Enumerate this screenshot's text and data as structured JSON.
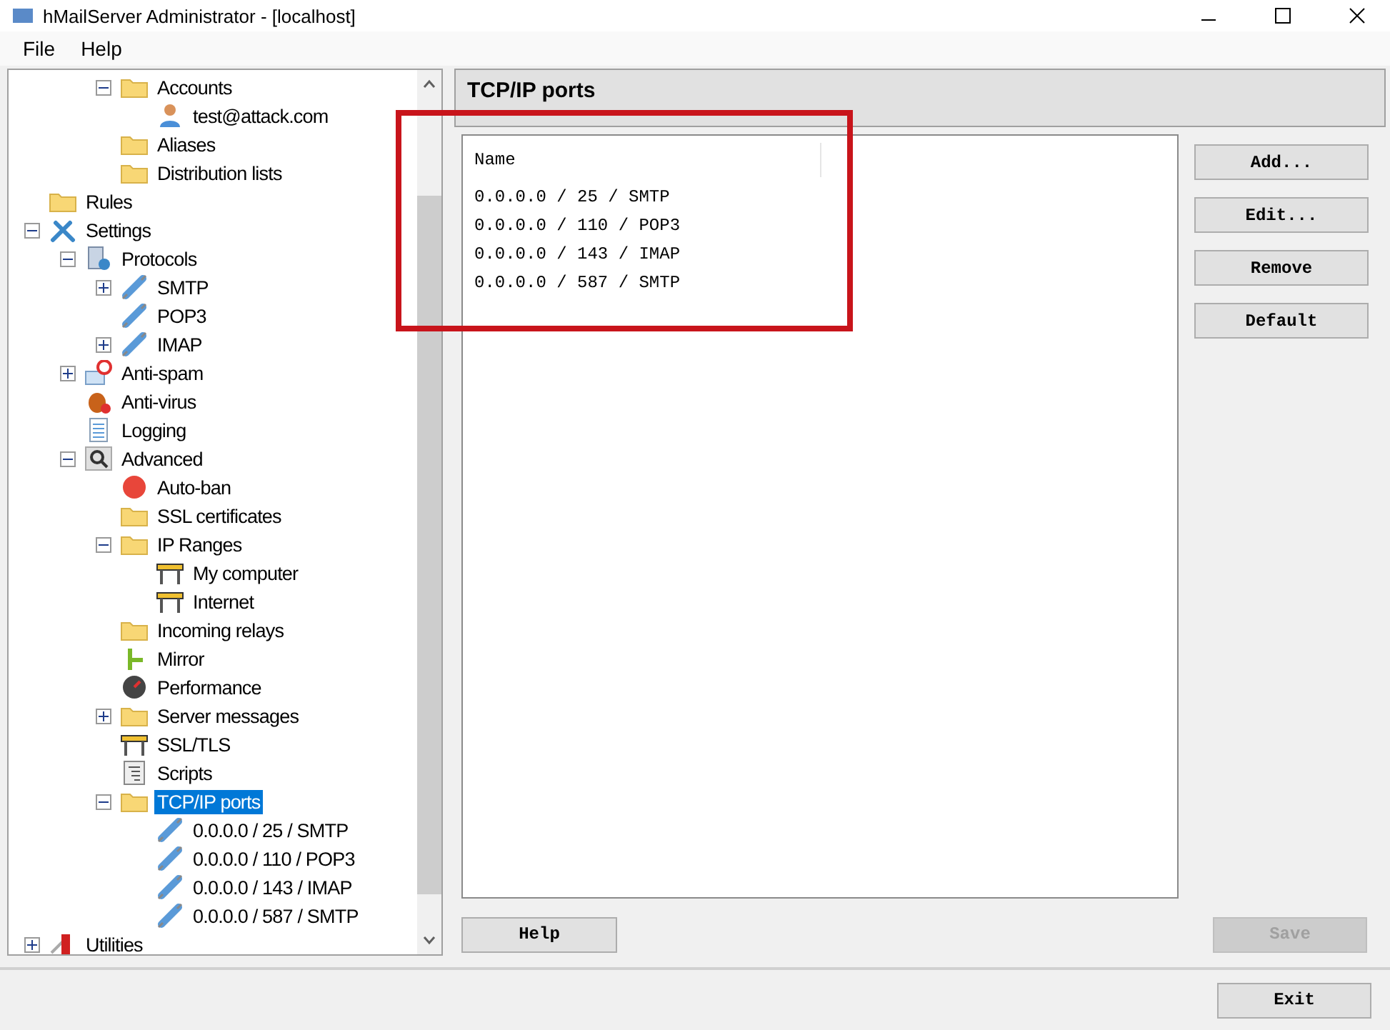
{
  "window": {
    "title": "hMailServer Administrator - [localhost]"
  },
  "menu": [
    {
      "label": "File"
    },
    {
      "label": "Help"
    }
  ],
  "tree": {
    "partial_branch": [
      {
        "label": "Accounts",
        "kind": "folder",
        "expanded": true,
        "selected": false,
        "children": [
          {
            "label": "test@attack.com",
            "kind": "user",
            "selected": false
          }
        ]
      },
      {
        "label": "Aliases",
        "kind": "folder",
        "selected": false
      },
      {
        "label": "Distribution lists",
        "kind": "folder",
        "selected": false
      }
    ],
    "items": [
      {
        "label": "Rules",
        "kind": "folder",
        "selected": false
      },
      {
        "label": "Settings",
        "kind": "tools",
        "expanded": true,
        "selected": false,
        "children": [
          {
            "label": "Protocols",
            "kind": "server",
            "expanded": true,
            "selected": false,
            "children": [
              {
                "label": "SMTP",
                "kind": "plug",
                "expanded": false,
                "selected": false
              },
              {
                "label": "POP3",
                "kind": "plug",
                "selected": false
              },
              {
                "label": "IMAP",
                "kind": "plug",
                "expanded": false,
                "selected": false
              }
            ]
          },
          {
            "label": "Anti-spam",
            "kind": "antispam",
            "expanded": false,
            "selected": false
          },
          {
            "label": "Anti-virus",
            "kind": "bug",
            "selected": false
          },
          {
            "label": "Logging",
            "kind": "log",
            "selected": false
          },
          {
            "label": "Advanced",
            "kind": "magnifier",
            "expanded": true,
            "selected": false,
            "children": [
              {
                "label": "Auto-ban",
                "kind": "stop",
                "selected": false
              },
              {
                "label": "SSL certificates",
                "kind": "folder",
                "selected": false
              },
              {
                "label": "IP Ranges",
                "kind": "folder",
                "expanded": true,
                "selected": false,
                "children": [
                  {
                    "label": "My computer",
                    "kind": "barrier",
                    "selected": false
                  },
                  {
                    "label": "Internet",
                    "kind": "barrier",
                    "selected": false
                  }
                ]
              },
              {
                "label": "Incoming relays",
                "kind": "folder",
                "selected": false
              },
              {
                "label": "Mirror",
                "kind": "signpost",
                "selected": false
              },
              {
                "label": "Performance",
                "kind": "gauge",
                "selected": false
              },
              {
                "label": "Server messages",
                "kind": "folder",
                "expanded": false,
                "selected": false
              },
              {
                "label": "SSL/TLS",
                "kind": "barrier",
                "selected": false
              },
              {
                "label": "Scripts",
                "kind": "script",
                "selected": false
              },
              {
                "label": "TCP/IP ports",
                "kind": "folder",
                "expanded": true,
                "selected": true,
                "children": [
                  {
                    "label": "0.0.0.0 / 25 / SMTP",
                    "kind": "plug",
                    "selected": false
                  },
                  {
                    "label": "0.0.0.0 / 110 / POP3",
                    "kind": "plug",
                    "selected": false
                  },
                  {
                    "label": "0.0.0.0 / 143 / IMAP",
                    "kind": "plug",
                    "selected": false
                  },
                  {
                    "label": "0.0.0.0 / 587 / SMTP",
                    "kind": "plug",
                    "selected": false
                  }
                ]
              }
            ]
          }
        ]
      },
      {
        "label": "Utilities",
        "kind": "knife",
        "expanded": false,
        "selected": false
      }
    ]
  },
  "panel": {
    "title": "TCP/IP ports",
    "list": {
      "columns": [
        "Name"
      ],
      "highlighted": true,
      "rows": [
        "0.0.0.0 / 25 / SMTP",
        "0.0.0.0 / 110 / POP3",
        "0.0.0.0 / 143 / IMAP",
        "0.0.0.0 / 587 / SMTP"
      ]
    },
    "side_buttons": [
      {
        "label": "Add...",
        "disabled": false
      },
      {
        "label": "Edit...",
        "disabled": false
      },
      {
        "label": "Remove",
        "disabled": false
      },
      {
        "label": "Default",
        "disabled": false
      }
    ],
    "help_button": {
      "label": "Help",
      "disabled": false
    },
    "save_button": {
      "label": "Save",
      "disabled": true
    }
  },
  "exit_button": {
    "label": "Exit",
    "disabled": false
  }
}
